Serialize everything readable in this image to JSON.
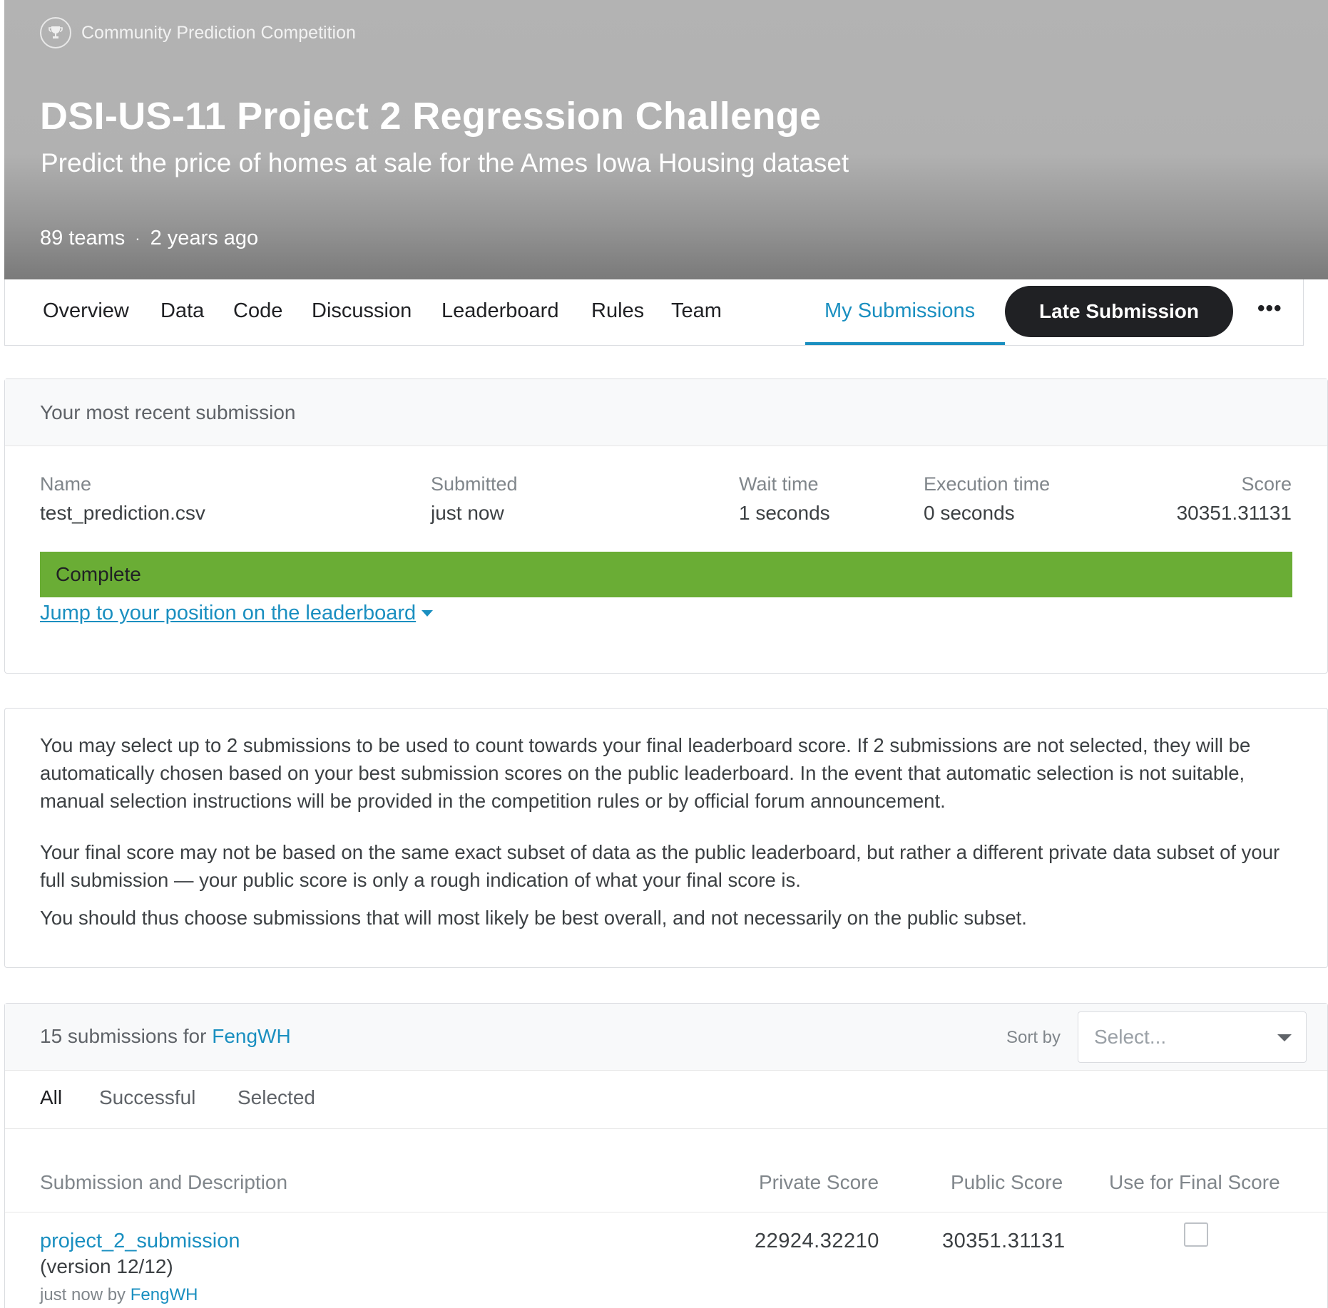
{
  "header": {
    "competition_type": "Community Prediction Competition",
    "title": "DSI-US-11 Project 2 Regression Challenge",
    "subtitle": "Predict the price of homes at sale for the Ames Iowa Housing dataset",
    "teams": "89 teams",
    "separator": "·",
    "age": "2 years ago"
  },
  "tabs": {
    "overview": "Overview",
    "data": "Data",
    "code": "Code",
    "discussion": "Discussion",
    "leaderboard": "Leaderboard",
    "rules": "Rules",
    "team": "Team",
    "my_submissions": "My Submissions",
    "late_submission": "Late Submission",
    "more": "•••",
    "active_tab": "My Submissions"
  },
  "recent": {
    "heading": "Your most recent submission",
    "labels": {
      "name": "Name",
      "submitted": "Submitted",
      "wait_time": "Wait time",
      "execution_time": "Execution time",
      "score": "Score"
    },
    "values": {
      "name": "test_prediction.csv",
      "submitted": "just now",
      "wait_time": "1 seconds",
      "execution_time": "0 seconds",
      "score": "30351.31131"
    },
    "status": "Complete",
    "status_color": "#6aad35",
    "jump_link": "Jump to your position on the leaderboard"
  },
  "info": {
    "paragraph_1": "You may select up to 2 submissions to be used to count towards your final leaderboard score. If 2 submissions are not selected, they will be automatically chosen based on your best submission scores on the public leaderboard. In the event that automatic selection is not suitable, manual selection instructions will be provided in the competition rules or by official forum announcement.",
    "paragraph_2": "Your final score may not be based on the same exact subset of data as the public leaderboard, but rather a different private data subset of your full submission — your public score is only a rough indication of what your final score is.",
    "paragraph_3": "You should thus choose submissions that will most likely be best overall, and not necessarily on the public subset."
  },
  "submissions": {
    "count_text": "15 submissions for",
    "user": "FengWH",
    "sort_label": "Sort by",
    "sort_placeholder": "Select...",
    "filters": {
      "all": "All",
      "successful": "Successful",
      "selected": "Selected",
      "active_filter": "All"
    },
    "columns": {
      "description": "Submission and Description",
      "private": "Private Score",
      "public": "Public Score",
      "final": "Use for Final Score"
    },
    "rows": [
      {
        "name": "project_2_submission",
        "version": "(version 12/12)",
        "time": "just now by",
        "user": "FengWH",
        "private_score": "22924.32210",
        "public_score": "30351.31131",
        "use_for_final": false
      }
    ]
  },
  "colors": {
    "accent": "#1a8fc0",
    "dark_button": "#202124",
    "complete_green": "#6aad35"
  },
  "icons": {
    "badge": "trophy-icon",
    "dropdown": "chevron-down-icon",
    "jump": "caret-down-icon"
  }
}
